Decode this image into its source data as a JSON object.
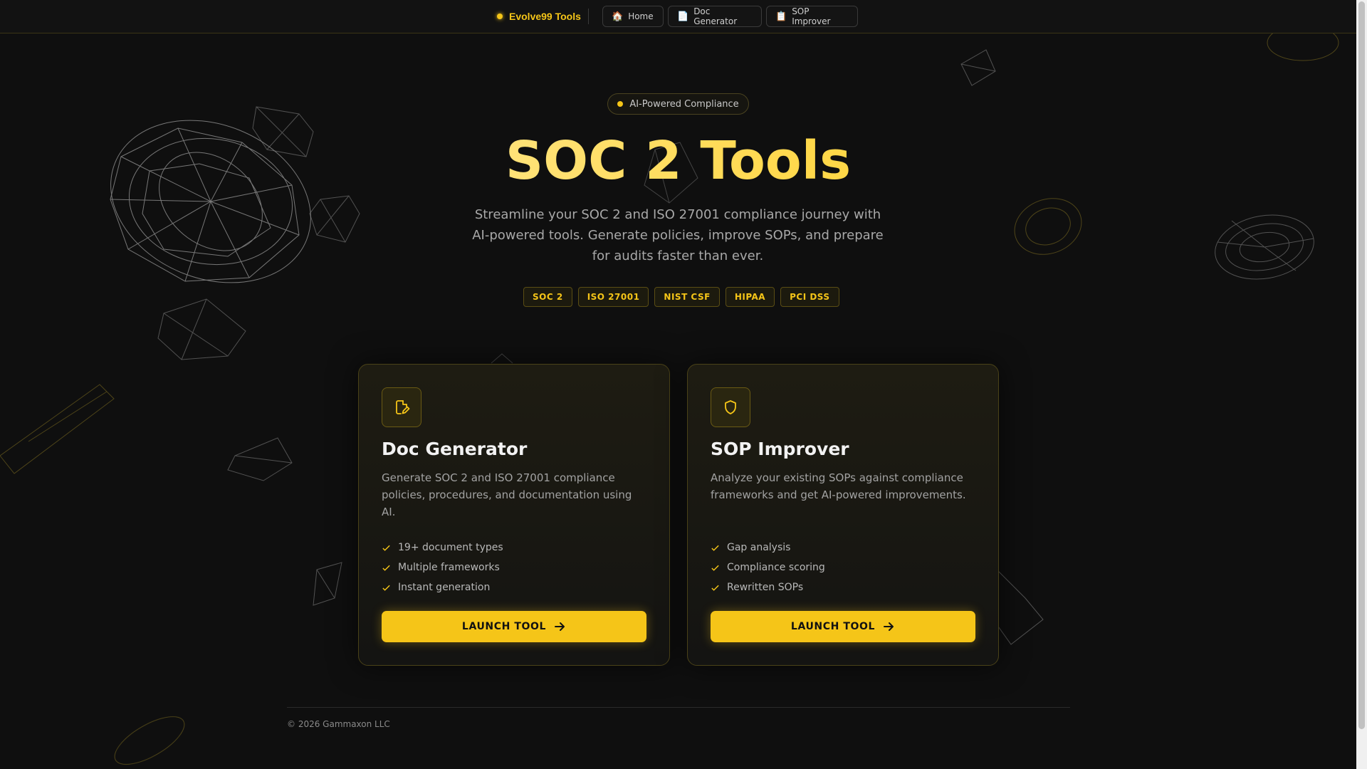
{
  "nav": {
    "brand": "Evolve99 Tools",
    "items": [
      {
        "label": "Home",
        "icon": "🏠"
      },
      {
        "label": "Doc Generator",
        "icon": "📄"
      },
      {
        "label": "SOP Improver",
        "icon": "📋"
      }
    ]
  },
  "hero": {
    "badge": "AI-Powered Compliance",
    "title": "SOC 2 Tools",
    "subtitle": "Streamline your SOC 2 and ISO 27001 compliance journey with AI-powered tools. Generate policies, improve SOPs, and prepare for audits faster than ever.",
    "tags": [
      "SOC 2",
      "ISO 27001",
      "NIST CSF",
      "HIPAA",
      "PCI DSS"
    ]
  },
  "cards": [
    {
      "title": "Doc Generator",
      "description": "Generate SOC 2 and ISO 27001 compliance policies, procedures, and documentation using AI.",
      "features": [
        "19+ document types",
        "Multiple frameworks",
        "Instant generation"
      ],
      "button": "LAUNCH TOOL",
      "icon": "file-edit-icon"
    },
    {
      "title": "SOP Improver",
      "description": "Analyze your existing SOPs against compliance frameworks and get AI-powered improvements.",
      "features": [
        "Gap analysis",
        "Compliance scoring",
        "Rewritten SOPs"
      ],
      "button": "LAUNCH TOOL",
      "icon": "shield-icon"
    }
  ],
  "footer": {
    "copyright": "© 2026 Gammaxon LLC"
  },
  "colors": {
    "accent": "#f5c518",
    "background": "#0f0f0f",
    "card_border": "#4a4218"
  }
}
